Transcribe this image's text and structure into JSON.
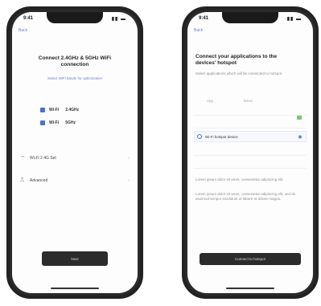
{
  "left_phone": {
    "status": {
      "time": "9:41",
      "icons": "▮▮ ▬"
    },
    "back_label": "Back",
    "title": "Connect 2.4GHz & 5GHz WiFi connection",
    "subtitle": "Select WiFi bands for optimization",
    "bands": [
      {
        "name": "Wi-Fi",
        "value": "2.4GHz",
        "checked": true
      },
      {
        "name": "Wi-Fi",
        "value": "5GHz",
        "checked": true
      }
    ],
    "settings": [
      {
        "label": "Wi-Fi 2.4G Set",
        "value": "›",
        "icon": "wifi-icon"
      },
      {
        "label": "Advanced",
        "value": "›",
        "icon": "router-icon"
      }
    ],
    "button_label": "Next"
  },
  "right_phone": {
    "status": {
      "time": "9:41",
      "icons": "▮▮ ▬"
    },
    "back_label": "Back",
    "title": "Connect your applications to the devices' hotspot",
    "description": "Select applications which will be connected to hotspot",
    "columns": [
      "App",
      "Band"
    ],
    "apps": [
      {
        "name": "",
        "tag": "",
        "selected": false
      },
      {
        "name": "",
        "tag": "",
        "selected": false
      },
      {
        "name": "Wi-Fi hotspot device",
        "tag": "◉",
        "selected": true
      },
      {
        "name": "",
        "tag": "",
        "selected": false
      },
      {
        "name": "",
        "tag": "",
        "selected": false
      }
    ],
    "note_1": "Lorem ipsum dolor sit amet, consectetur adipiscing elit.",
    "note_2": "Lorem ipsum dolor sit amet, consectetur adipiscing elit, sed do eiusmod tempor incididunt ut labore et dolore magna.",
    "button_label": "Connect to hotspot"
  },
  "colors": {
    "accent": "#4a70d0",
    "button": "#2b2b2b",
    "frame": "#222222"
  }
}
